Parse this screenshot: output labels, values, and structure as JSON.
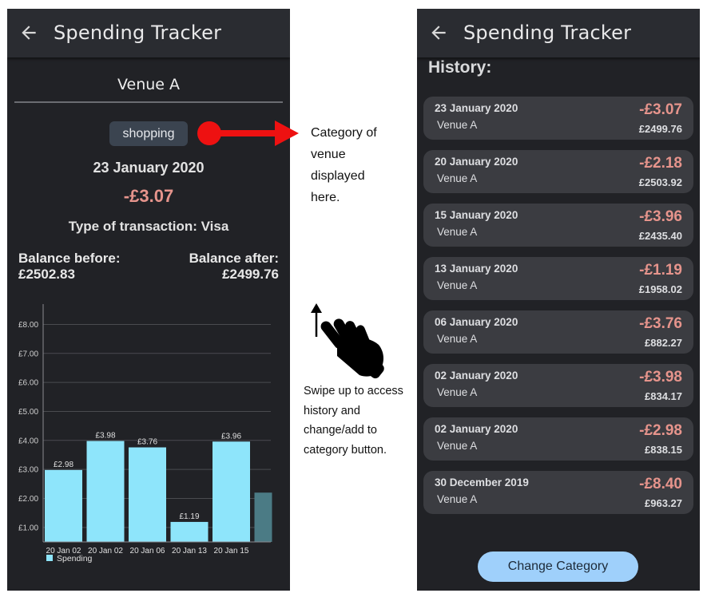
{
  "left_screen": {
    "appbar": {
      "title": "Spending Tracker",
      "back_icon": "arrow-left-icon"
    },
    "venue": "Venue A",
    "category": "shopping",
    "date": "23 January 2020",
    "amount": "-£3.07",
    "transaction_type": "Type of transaction: Visa",
    "balance_before": {
      "label": "Balance before:",
      "value": "£2502.83"
    },
    "balance_after": {
      "label": "Balance after:",
      "value": "£2499.76"
    }
  },
  "chart_data": {
    "type": "bar",
    "categories": [
      "20 Jan 02",
      "20 Jan 02",
      "20 Jan 06",
      "20 Jan 13",
      "20 Jan 15",
      ""
    ],
    "series": [
      {
        "name": "Spending",
        "values": [
          2.98,
          3.98,
          3.76,
          1.19,
          3.96,
          2.2
        ]
      }
    ],
    "data_labels": [
      "£2.98",
      "£3.98",
      "£3.76",
      "£1.19",
      "£3.96",
      ""
    ],
    "y_ticks": [
      "£1.00",
      "£2.00",
      "£3.00",
      "£4.00",
      "£5.00",
      "£6.00",
      "£7.00",
      "£8.00"
    ],
    "ylim": [
      0.5,
      8.7
    ],
    "grid": true,
    "legend": "bottom-left",
    "bar_color": "#8ee5fb",
    "bar_color_partial": "#4b7b85"
  },
  "annotations": {
    "category_note": [
      "Category of",
      "venue",
      "displayed",
      "here."
    ],
    "swipe_note": [
      "Swipe up to access",
      "history and",
      "change/add to",
      "category button."
    ],
    "arrow_color": "#ee1111",
    "hand_icon": "swipe-up-hand-icon"
  },
  "right_screen": {
    "appbar": {
      "title": "Spending Tracker",
      "back_icon": "arrow-left-icon"
    },
    "history_title": "History:",
    "history": [
      {
        "date": "23 January 2020",
        "venue": "Venue A",
        "amount": "-£3.07",
        "balance": "£2499.76"
      },
      {
        "date": "20 January 2020",
        "venue": "Venue A",
        "amount": "-£2.18",
        "balance": "£2503.92"
      },
      {
        "date": "15 January 2020",
        "venue": "Venue A",
        "amount": "-£3.96",
        "balance": "£2435.40"
      },
      {
        "date": "13 January 2020",
        "venue": "Venue A",
        "amount": "-£1.19",
        "balance": "£1958.02"
      },
      {
        "date": "06 January 2020",
        "venue": "Venue A",
        "amount": "-£3.76",
        "balance": "£882.27"
      },
      {
        "date": "02 January 2020",
        "venue": "Venue A",
        "amount": "-£3.98",
        "balance": "£834.17"
      },
      {
        "date": "02 January 2020",
        "venue": "Venue A",
        "amount": "-£2.98",
        "balance": "£838.15"
      },
      {
        "date": "30 December 2019",
        "venue": "Venue A",
        "amount": "-£8.40",
        "balance": "£963.27"
      }
    ],
    "change_button": "Change Category"
  }
}
